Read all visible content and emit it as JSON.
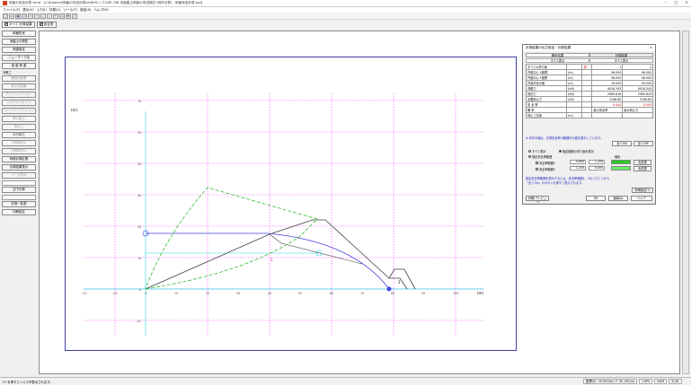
{
  "window": {
    "title": "斜面の安定計算 Ver.6 - [C:¥Usersr¥斜面の安定計算ver6¥サンプル¥P-798 法面盛土斜面の安定検討 (例外計算) - 斜面安定計算.ssd]",
    "controls": [
      "–",
      "□",
      "×"
    ]
  },
  "menu": [
    "ファイル(F)",
    "表示(V)",
    "入力(I)",
    "計算(C)",
    "ツール(T)",
    "設定(S)",
    "ヘルプ(H)"
  ],
  "toolbar": [
    "□",
    "▭",
    "▣",
    "⎙",
    "+",
    "−",
    "⌕",
    "⌕",
    "↶",
    "▭",
    "✚",
    "?"
  ],
  "tabs": [
    {
      "label": "すべて",
      "checked": "✔",
      "suffix": "計算結果"
    },
    {
      "label": "",
      "checked": "✔",
      "suffix": "設定表"
    }
  ],
  "sidebar": {
    "buttons": [
      {
        "label": "斜面形状",
        "disabled": false
      },
      {
        "label": "地盤土の物性",
        "disabled": false
      },
      {
        "label": "荷重設定",
        "disabled": false
      },
      {
        "label": "ニューマーク法",
        "disabled": false
      },
      {
        "label": "地 震 荷 重",
        "disabled": false
      }
    ],
    "section_label": "対策工",
    "buttons2": [
      {
        "label": "補強材設置",
        "disabled": true
      },
      {
        "label": "抑止杭設置",
        "disabled": true
      },
      {
        "label": "グラウンドアンカー",
        "disabled": true
      },
      {
        "label": "ジオテキスタイル",
        "disabled": true
      },
      {
        "label": "サンドコンパクション",
        "disabled": true
      },
      {
        "label": "押え盛土",
        "disabled": true
      },
      {
        "label": "排水工",
        "disabled": true
      },
      {
        "label": "のり枠工",
        "disabled": false
      }
    ],
    "buttons3": [
      {
        "label": "計算条件1",
        "disabled": true
      },
      {
        "label": "計算条件2",
        "disabled": true
      },
      {
        "label": "斜面計算区間",
        "disabled": false
      },
      {
        "label": "計算結果表示",
        "disabled": false
      },
      {
        "label": "データ表示",
        "disabled": true
      }
    ],
    "field": "",
    "buttons4": [
      {
        "label": "沈下計算",
        "disabled": false
      }
    ],
    "field2": "",
    "buttons5": [
      {
        "label": "計算一覧表",
        "disabled": false
      },
      {
        "label": "印刷設定",
        "disabled": false
      }
    ]
  },
  "plot": {
    "unit_label": "(m)",
    "unit_label_x": "(m)",
    "x_ticks": [
      "-20",
      "-10",
      "0",
      "10",
      "20",
      "30",
      "40",
      "50",
      "60",
      "70",
      "80",
      "90",
      "100",
      "110",
      "120",
      "130",
      "140"
    ],
    "y_ticks": [
      "70",
      "50",
      "40",
      "30",
      "20",
      "10",
      "0",
      "-10",
      "-20",
      "-30",
      "-40"
    ],
    "marker_labels": [
      "1",
      "2"
    ]
  },
  "dialog": {
    "title": "計算結果の出力設定 : 計算結果",
    "close": "×",
    "tabs": [
      "解析結果",
      "計算結果"
    ],
    "subtabs": [
      "すべて表示",
      "すべて表示"
    ],
    "table": {
      "rows": [
        [
          "すべての滑り面",
          "",
          "現",
          "1",
          "2"
        ],
        [
          "円弧中心 X座標",
          "(m)",
          "",
          "96.000",
          "96.000"
        ],
        [
          "円弧中心 Y座標",
          "(m)",
          "",
          "56.000",
          "56.000"
        ],
        [
          "円弧半径の値",
          "(m)",
          "",
          "10.000",
          "50.000"
        ],
        [
          "滑動力",
          "(kN)",
          "",
          "4016.343",
          "4016.343"
        ],
        [
          "抵抗力",
          "(kN)",
          "",
          "2960.816",
          "2960.816"
        ],
        [
          "必要抑止力",
          "(kN)",
          "",
          "2168.80",
          "2168.80"
        ],
        [
          "安 全 率",
          "",
          "",
          "0.000",
          "0.000"
        ],
        [
          "備    考",
          "",
          "",
          "最小安全率",
          "最大抑止力"
        ],
        [
          "抑止工位置",
          "(m)",
          "",
          "",
          ""
        ]
      ]
    },
    "note1": "※ 赤字の値は、計算安全率の範囲外の値を表示しています。",
    "btn_on": "全てON",
    "btn_off": "全てOFF",
    "opt_all": "すべて表示",
    "opt_range": "指定範囲の滑り面を表示",
    "opt_area": "指定安全率範囲",
    "color_label": "線色",
    "range1_label": "安全率範囲1",
    "range1_from": "0.800",
    "range1_to": "1.200",
    "range2_label": "安全率範囲2",
    "range2_from": "1.200",
    "range2_to": "0.000",
    "color_btn1": "色変更",
    "color_btn2": "色変更",
    "note2": "指定安全率範囲を表示するには、安全率範囲1、2を入力してから",
    "note3": "「全てON」のボタンを押すと表示されます。",
    "btn_print": "印刷(プレビュー)",
    "btn_ok": "OK",
    "btn_apply": "適用(A)",
    "btn_help": "ヘルプ",
    "btn_detail": "詳細設定(T)"
  },
  "status": {
    "left": "F1 を押すとヘルプが表示されます。",
    "cells": [
      "座標(X): 10.603(m)  Y: 30.135(m)",
      "CAPS",
      "NUM",
      "SCRL"
    ]
  },
  "colors": {
    "grid": "#ff40ff",
    "ground": "#404040",
    "slip_blue": "#4040e0",
    "slip_green": "#30c030",
    "axis_cyan": "#30d0e0"
  }
}
